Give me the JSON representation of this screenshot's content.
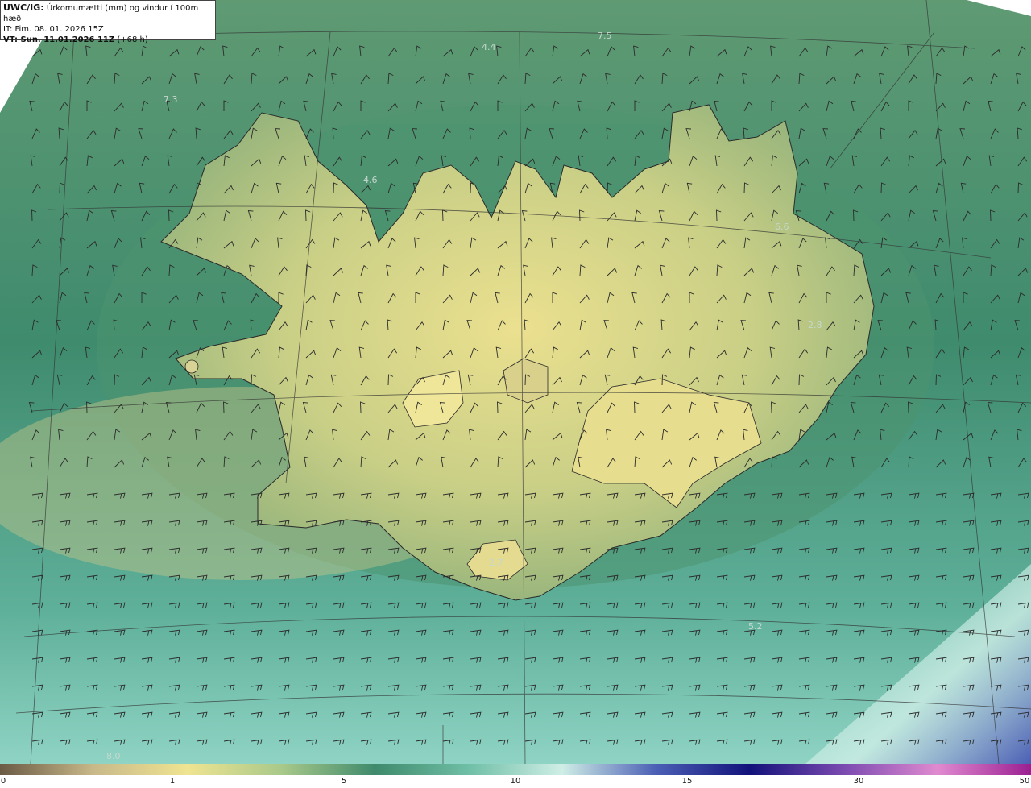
{
  "header": {
    "product": "UWC/IG:",
    "title": "Úrkomumætti (mm) og vindur í 100m hæð",
    "init_time": "IT: Fim. 08. 01. 2026 15Z",
    "valid_prefix": "VT: Sun. 11.01.2026 11Z",
    "valid_suffix": "(+68 h)"
  },
  "map_labels": [
    {
      "text": "4.4"
    },
    {
      "text": "7.5"
    },
    {
      "text": "7.3"
    },
    {
      "text": "4.6"
    },
    {
      "text": "6.6"
    },
    {
      "text": "2.8"
    },
    {
      "text": "5.2"
    },
    {
      "text": "2.7"
    },
    {
      "text": "8.0"
    }
  ],
  "colorbar": {
    "ticks": [
      "0",
      "1",
      "5",
      "10",
      "15",
      "30",
      "50"
    ],
    "colors": [
      "#6b5a45",
      "#c8b98a",
      "#efe491",
      "#a9c98a",
      "#3f8a6c",
      "#6fbfa6",
      "#cfeee6",
      "#4b5fb5",
      "#12127a",
      "#7a4ab0",
      "#e08ad0",
      "#9b1f92"
    ]
  }
}
